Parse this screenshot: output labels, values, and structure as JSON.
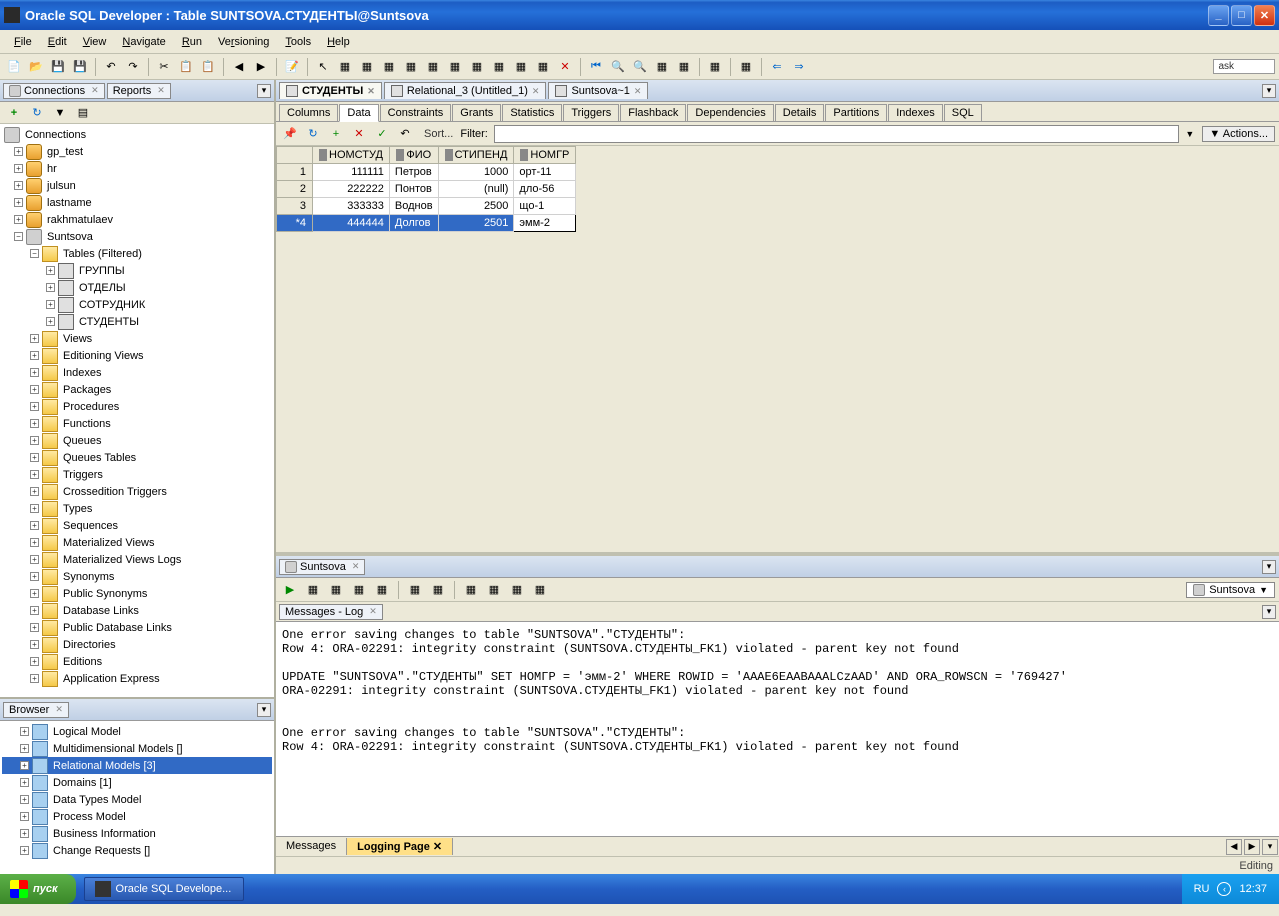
{
  "window": {
    "title": "Oracle SQL Developer : Table SUNTSOVA.СТУДЕНТЫ@Suntsova"
  },
  "menubar": [
    "File",
    "Edit",
    "View",
    "Navigate",
    "Run",
    "Versioning",
    "Tools",
    "Help"
  ],
  "ask_label": "ask",
  "left": {
    "tabs": {
      "connections": "Connections",
      "reports": "Reports"
    },
    "root": "Connections",
    "conns": [
      "gp_test",
      "hr",
      "julsun",
      "lastname",
      "rakhmatulaev"
    ],
    "active_conn": "Suntsova",
    "tables_label": "Tables (Filtered)",
    "tables": [
      "ГРУППЫ",
      "ОТДЕЛЫ",
      "СОТРУДНИК",
      "СТУДЕНТЫ"
    ],
    "folders": [
      "Views",
      "Editioning Views",
      "Indexes",
      "Packages",
      "Procedures",
      "Functions",
      "Queues",
      "Queues Tables",
      "Triggers",
      "Crossedition Triggers",
      "Types",
      "Sequences",
      "Materialized Views",
      "Materialized Views Logs",
      "Synonyms",
      "Public Synonyms",
      "Database Links",
      "Public Database Links",
      "Directories",
      "Editions",
      "Application Express"
    ]
  },
  "browser": {
    "tab": "Browser",
    "items": [
      "Logical Model",
      "Multidimensional Models []",
      "Relational Models [3]",
      "Domains [1]",
      "Data Types Model",
      "Process Model",
      "Business Information",
      "Change Requests []"
    ],
    "selected_index": 2
  },
  "editor": {
    "tabs": [
      {
        "label": "СТУДЕНТЫ",
        "active": true
      },
      {
        "label": "Relational_3 (Untitled_1)",
        "active": false
      },
      {
        "label": "Suntsova~1",
        "active": false
      }
    ],
    "subtabs": [
      "Columns",
      "Data",
      "Constraints",
      "Grants",
      "Statistics",
      "Triggers",
      "Flashback",
      "Dependencies",
      "Details",
      "Partitions",
      "Indexes",
      "SQL"
    ],
    "active_subtab": "Data",
    "sort_label": "Sort...",
    "filter_label": "Filter:",
    "actions_label": "▼ Actions...",
    "columns": [
      "НОМСТУД",
      "ФИО",
      "СТИПЕНД",
      "НОМГР"
    ],
    "rows": [
      {
        "n": "1",
        "c": [
          "111111",
          "Петров",
          "1000",
          "орт-11"
        ]
      },
      {
        "n": "2",
        "c": [
          "222222",
          "Понтов",
          "(null)",
          "дло-56"
        ]
      },
      {
        "n": "3",
        "c": [
          "333333",
          "Воднов",
          "2500",
          "що-1"
        ]
      },
      {
        "n": "*4",
        "c": [
          "444444",
          "Долгов",
          "2501",
          "эмм-2"
        ]
      }
    ],
    "selected_row": 3,
    "editing_col": 3
  },
  "sql": {
    "tab": "Suntsova",
    "conn_label": "Suntsova",
    "msg_tab": "Messages - Log",
    "log": "One error saving changes to table \"SUNTSOVA\".\"СТУДЕНТЫ\":\nRow 4: ORA-02291: integrity constraint (SUNTSOVA.СТУДЕНТЫ_FK1) violated - parent key not found\n\nUPDATE \"SUNTSOVA\".\"СТУДЕНТЫ\" SET НОМГР = 'эмм-2' WHERE ROWID = 'AAAE6EAABAAALCzAAD' AND ORA_ROWSCN = '769427'\nORA-02291: integrity constraint (SUNTSOVA.СТУДЕНТЫ_FK1) violated - parent key not found\n\n\nOne error saving changes to table \"SUNTSOVA\".\"СТУДЕНТЫ\":\nRow 4: ORA-02291: integrity constraint (SUNTSOVA.СТУДЕНТЫ_FK1) violated - parent key not found",
    "bottom_tabs": [
      "Messages",
      "Logging Page"
    ],
    "active_bottom": 1
  },
  "status": "Editing",
  "taskbar": {
    "start": "пуск",
    "app": "Oracle SQL Develope...",
    "lang": "RU",
    "time": "12:37"
  }
}
